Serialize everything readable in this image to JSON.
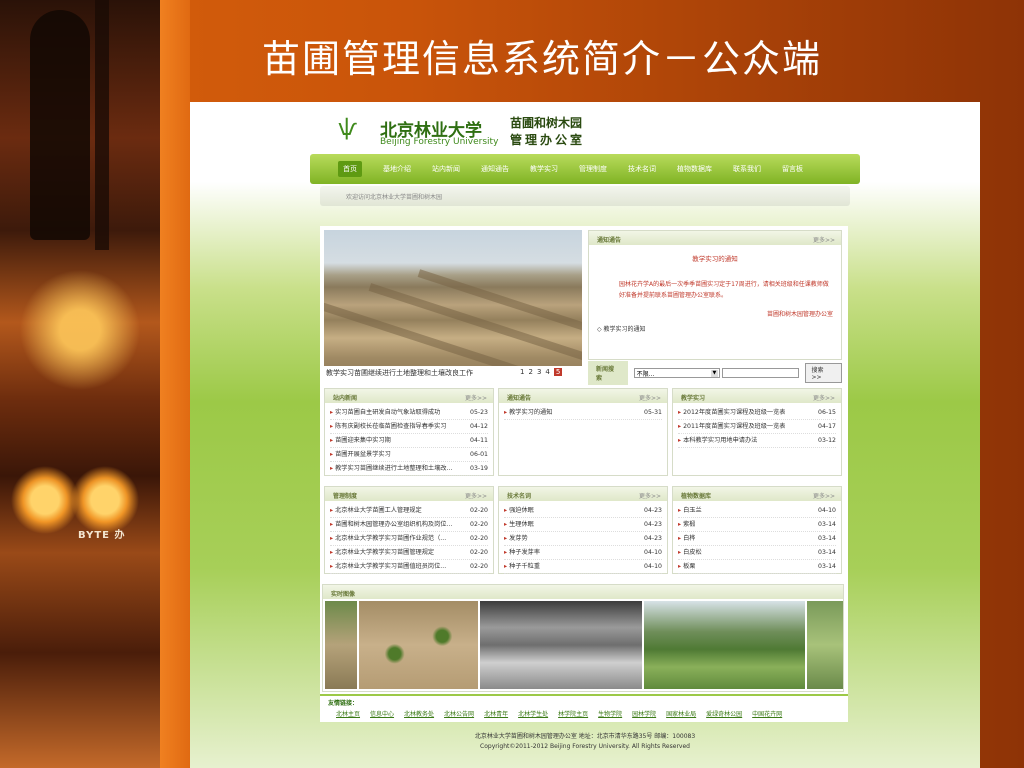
{
  "slide": {
    "title": "苗圃管理信息系统简介－公众端"
  },
  "decor": {
    "badge": "BYTE 办"
  },
  "site": {
    "logo_text": "北京林业大学",
    "logo_sub": "Beijing Forestry University",
    "dept_title": "苗圃和树木园",
    "dept_sub": "管理办公室",
    "nav": [
      "首页",
      "基地介绍",
      "站内新闻",
      "通知通告",
      "教学实习",
      "管理制度",
      "技术名词",
      "植物数据库",
      "联系我们",
      "留言板"
    ],
    "welcome": "欢迎访问北京林业大学苗圃和树木园",
    "hero_caption": "教学实习苗圃继续进行土地整理和土壤改良工作",
    "pager": [
      "1",
      "2",
      "3",
      "4",
      "5"
    ],
    "notice": {
      "head": "通知通告",
      "more": "更多>>",
      "title": "教学实习的通知",
      "body": "园林花卉学A的最后一次季季苗圃实习定于17周进行，请相关班级和任课教师做好准备并提前联系苗圃管理办公室联系。",
      "sign": "苗圃和树木园管理办公室",
      "item": "◇ 教学实习的通知"
    },
    "search": {
      "label": "新闻搜索",
      "select_value": "不限...",
      "button": "搜索 >>"
    },
    "panels": {
      "news": {
        "head": "站内新闻",
        "more": "更多>>",
        "items": [
          {
            "t": "实习苗圃自主研发自动气象站取得成功",
            "d": "05-23"
          },
          {
            "t": "陈有庆副校长莅临苗圃检查指导春季实习",
            "d": "04-12"
          },
          {
            "t": "苗圃迎来集中实习期",
            "d": "04-11"
          },
          {
            "t": "苗圃开展盆景学实习",
            "d": "06-01"
          },
          {
            "t": "教学实习苗圃继续进行土地整理和土壤改良...",
            "d": "03-19"
          }
        ]
      },
      "notices": {
        "head": "通知通告",
        "more": "更多>>",
        "items": [
          {
            "t": "教学实习的通知",
            "d": "05-31"
          }
        ]
      },
      "teaching": {
        "head": "教学实习",
        "more": "更多>>",
        "items": [
          {
            "t": "2012年度苗圃实习课程及班级一览表",
            "d": "06-15"
          },
          {
            "t": "2011年度苗圃实习课程及班级一览表",
            "d": "04-17"
          },
          {
            "t": "本科教学实习用地申请办法",
            "d": "03-12"
          }
        ]
      },
      "rules": {
        "head": "管理制度",
        "more": "更多>>",
        "items": [
          {
            "t": "北京林业大学苗圃工人管理规定",
            "d": "02-20"
          },
          {
            "t": "苗圃和树木园管理办公室组织机构及岗位...",
            "d": "02-20"
          },
          {
            "t": "北京林业大学教学实习苗圃作业规范（...",
            "d": "02-20"
          },
          {
            "t": "北京林业大学教学实习苗圃管理规定",
            "d": "02-20"
          },
          {
            "t": "北京林业大学教学实习苗圃值班员岗位...",
            "d": "02-20"
          }
        ]
      },
      "terms": {
        "head": "技术名词",
        "more": "更多>>",
        "items": [
          {
            "t": "强迫休眠",
            "d": "04-23"
          },
          {
            "t": "生理休眠",
            "d": "04-23"
          },
          {
            "t": "发芽势",
            "d": "04-23"
          },
          {
            "t": "种子发芽率",
            "d": "04-10"
          },
          {
            "t": "种子千粒重",
            "d": "04-10"
          }
        ]
      },
      "plants": {
        "head": "植物数据库",
        "more": "更多>>",
        "items": [
          {
            "t": "白玉兰",
            "d": "04-10"
          },
          {
            "t": "紫椴",
            "d": "03-14"
          },
          {
            "t": "白桦",
            "d": "03-14"
          },
          {
            "t": "白皮松",
            "d": "03-14"
          },
          {
            "t": "板栗",
            "d": "03-14"
          }
        ]
      }
    },
    "photos_head": "实时图像",
    "links": {
      "title": "友情链接：",
      "items": [
        "北林主页",
        "信息中心",
        "北林教务处",
        "北林公告网",
        "北林青年",
        "北林学生处",
        "林学院主页",
        "生物学院",
        "园林学院",
        "国家林业局",
        "爱绿奇林公园",
        "中国花卉网"
      ]
    },
    "footer": {
      "line1": "北京林业大学苗圃和树木园管理办公室  地址：北京市清华东路35号 邮编：100083",
      "line2": "Copyright©2011-2012 Beijing Forestry University. All Rights Reserved"
    }
  }
}
